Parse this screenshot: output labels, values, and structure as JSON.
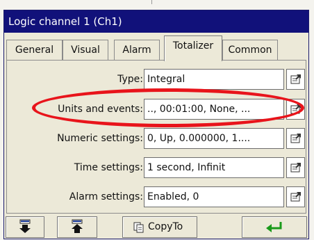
{
  "window": {
    "title": "Logic channel 1 (Ch1)"
  },
  "tabs": [
    {
      "label": "General"
    },
    {
      "label": "Visual"
    },
    {
      "label": "Alarm"
    },
    {
      "label": "Totalizer",
      "active": true
    },
    {
      "label": "Common"
    }
  ],
  "fields": [
    {
      "label": "Type:",
      "value": "Integral"
    },
    {
      "label": "Units and events:",
      "value": ".., 00:01:00, None, ..."
    },
    {
      "label": "Numeric settings:",
      "value": "0, Up, 0.000000, 1...."
    },
    {
      "label": "Time settings:",
      "value": "1 second, Infinit"
    },
    {
      "label": "Alarm settings:",
      "value": "Enabled, 0"
    }
  ],
  "toolbar": {
    "next_icon": "move-down-icon",
    "prev_icon": "move-up-icon",
    "copy_label": "CopyTo",
    "ok_icon": "enter-arrow-icon"
  },
  "colors": {
    "titlebar": "#11117a",
    "highlight": "#e8141b",
    "ok_arrow": "#1a9a1a"
  }
}
